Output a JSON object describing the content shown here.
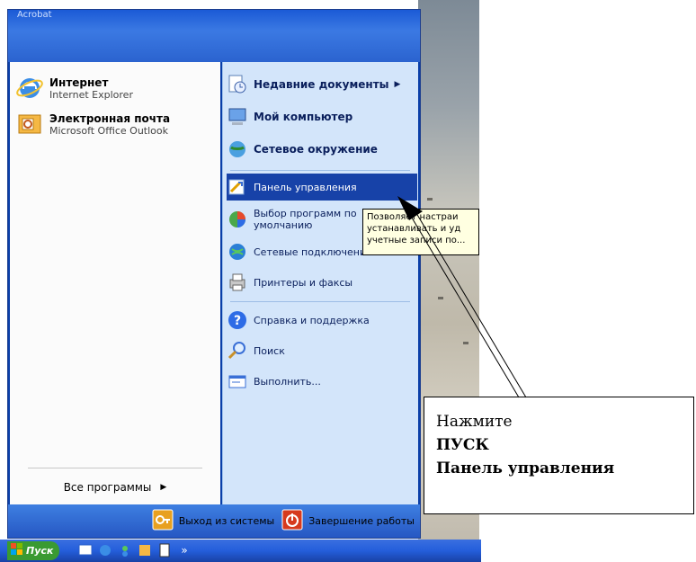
{
  "header": {
    "username": "Acrobat"
  },
  "left": {
    "pinned": [
      {
        "title": "Интернет",
        "subtitle": "Internet Explorer",
        "icon": "internet-explorer-icon"
      },
      {
        "title": "Электронная почта",
        "subtitle": "Microsoft Office Outlook",
        "icon": "outlook-icon"
      }
    ],
    "all_programs": "Все программы"
  },
  "right": {
    "items": [
      {
        "label": "Недавние документы",
        "icon": "recent-documents-icon",
        "bold": true,
        "arrow": true
      },
      {
        "label": "Мой компьютер",
        "icon": "my-computer-icon",
        "bold": true
      },
      {
        "label": "Сетевое окружение",
        "icon": "network-places-icon",
        "bold": true
      },
      {
        "label": "Панель управления",
        "icon": "control-panel-icon",
        "selected": true
      },
      {
        "label": "Выбор программ по умолчанию",
        "icon": "default-programs-icon"
      },
      {
        "label": "Сетевые подключения",
        "icon": "network-connections-icon"
      },
      {
        "label": "Принтеры и факсы",
        "icon": "printers-icon"
      },
      {
        "label": "Справка и поддержка",
        "icon": "help-icon"
      },
      {
        "label": "Поиск",
        "icon": "search-icon"
      },
      {
        "label": "Выполнить...",
        "icon": "run-icon"
      }
    ]
  },
  "footer": {
    "logoff": "Выход из системы",
    "shutdown": "Завершение работы"
  },
  "taskbar": {
    "start_label": "Пуск",
    "overflow": "»"
  },
  "tooltip": {
    "text": "Позволяет настраи устанавливать и уд учетные записи по..."
  },
  "callout": {
    "line1": "Нажмите",
    "line2": "ПУСК",
    "line3": "Панель управления"
  },
  "colors": {
    "start_blue": "#245edb",
    "selection": "#1742a8",
    "tooltip_bg": "#ffffe1"
  }
}
